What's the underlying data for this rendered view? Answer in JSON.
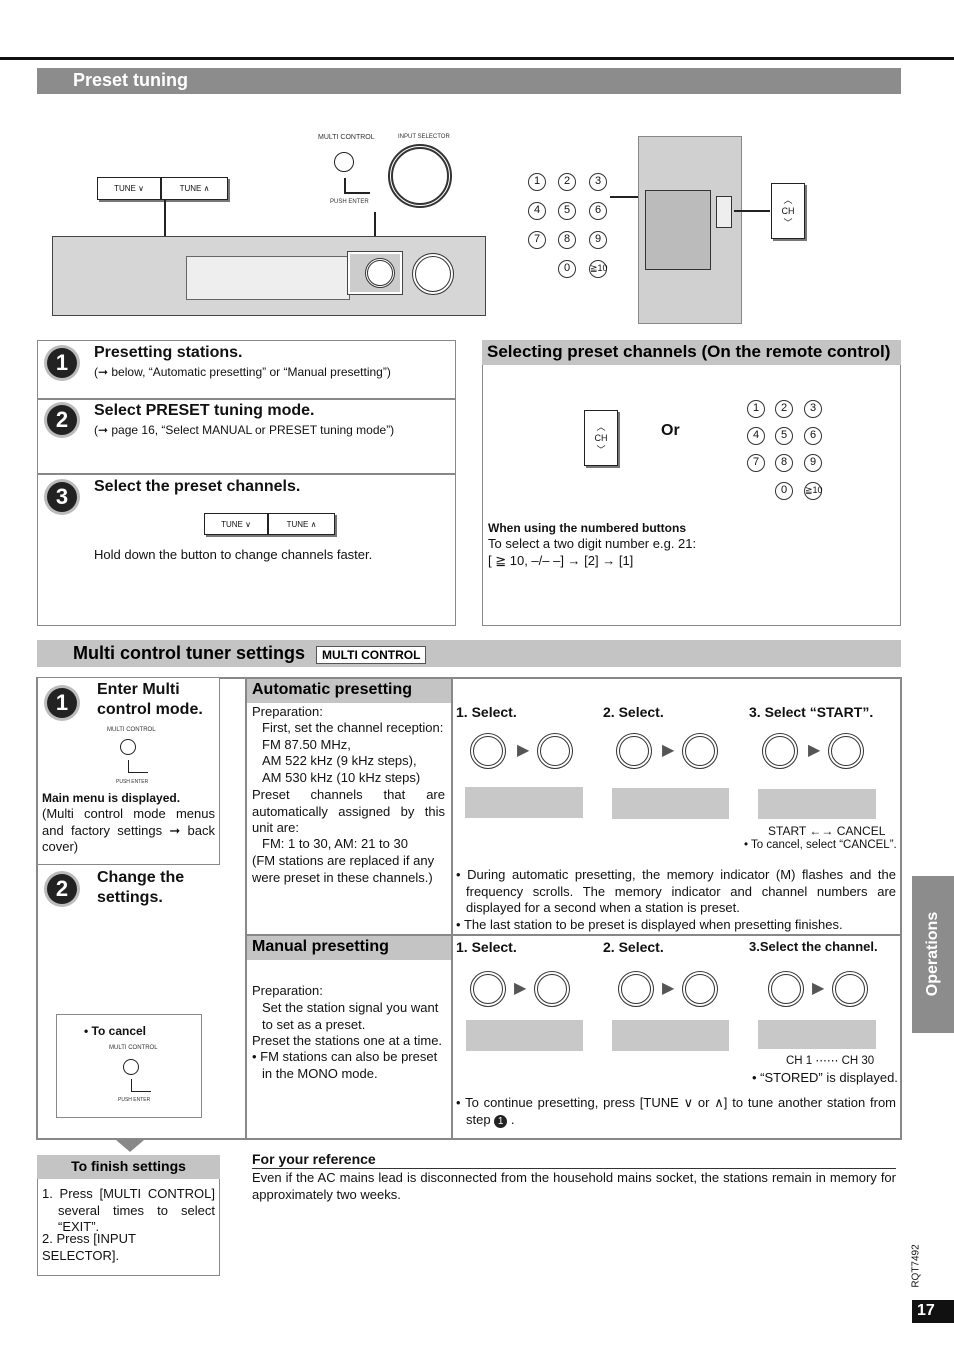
{
  "preset_tuning": {
    "title": "Preset tuning",
    "illustration": {
      "tune_down": "TUNE ∨",
      "tune_up": "TUNE ∧",
      "multi_control": "MULTI CONTROL",
      "push_enter": "PUSH ENTER",
      "input_selector": "INPUT SELECTOR",
      "ch": "CH"
    },
    "keypad": [
      "1",
      "2",
      "3",
      "4",
      "5",
      "6",
      "7",
      "8",
      "9",
      "0",
      "≧10"
    ],
    "steps": [
      {
        "num": "1",
        "title": "Presetting stations.",
        "note": "(➞ below, “Automatic presetting” or “Manual presetting”)"
      },
      {
        "num": "2",
        "title": "Select PRESET tuning mode.",
        "note": "(➞ page 16, “Select MANUAL or PRESET tuning mode”)"
      },
      {
        "num": "3",
        "title": "Select the preset channels.",
        "note": "Hold down the button to change channels faster."
      }
    ]
  },
  "selecting": {
    "title": "Selecting preset channels (On the remote control)",
    "or": "Or",
    "ch": "CH",
    "numbered_title": "When using the numbered buttons",
    "numbered_line1": "To select a two digit number e.g. 21:",
    "numbered_line2": "[ ≧ 10, –/– –] → [2] → [1]"
  },
  "multi": {
    "title": "Multi control tuner settings",
    "badge": "MULTI CONTROL",
    "step1": {
      "num": "1",
      "title": "Enter Multi control mode.",
      "main_menu": "Main menu is displayed.",
      "desc": "(Multi control mode menus and factory settings ➞ back cover)"
    },
    "step2": {
      "num": "2",
      "title": "Change the settings."
    },
    "to_cancel": "To cancel",
    "automatic": {
      "title": "Automatic presetting",
      "prep": [
        "Preparation:",
        "First, set the channel reception:",
        "FM 87.50 MHz,",
        "AM 522 kHz (9 kHz steps),",
        "AM 530 kHz (10 kHz steps)"
      ],
      "assigned": "Preset channels that are automatically assigned by this unit are:",
      "ranges": "FM: 1 to 30, AM: 21 to 30",
      "replaced": "(FM stations are replaced if any were preset in these channels.)",
      "steps": [
        "1. Select.",
        "2. Select.",
        "3. Select “START”."
      ],
      "start_cancel": [
        "START",
        "CANCEL"
      ],
      "cancel_note": "To cancel, select “CANCEL”.",
      "notes": [
        "During automatic presetting, the memory indicator (M) flashes and the frequency scrolls. The memory indicator and channel numbers are displayed for a second when a station is preset.",
        "The last station to be preset is displayed when presetting finishes."
      ]
    },
    "manual": {
      "title": "Manual presetting",
      "prep": [
        "Preparation:",
        "Set the station signal you want to set as a preset.",
        "Preset the stations one at a time.",
        "FM stations can also be preset in the MONO mode."
      ],
      "steps": [
        "1. Select.",
        "2. Select.",
        "3.Select the channel."
      ],
      "ch_range": [
        "CH 1",
        "CH 30"
      ],
      "stored": "“STORED” is displayed.",
      "note": "To continue presetting, press [TUNE ∨ or ∧] to tune another station from step"
    }
  },
  "finish": {
    "title": "To finish settings",
    "items": [
      "1. Press [MULTI CONTROL] several times to select “EXIT”.",
      "2. Press [INPUT SELECTOR]."
    ]
  },
  "reference": {
    "title": "For your reference",
    "text": "Even if the AC mains lead is disconnected from the household mains socket, the stations remain in memory for approximately two weeks."
  },
  "side_tab": "Operations",
  "doc_code": "RQT7492",
  "page_number": "17"
}
